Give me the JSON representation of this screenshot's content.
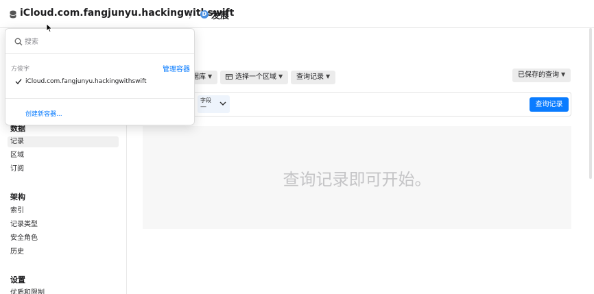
{
  "header": {
    "container_name": "iCloud.com.fangjunyu.hackingwithswift",
    "separator": "〉",
    "environment_badge": "D",
    "environment_name": "发展"
  },
  "sidebar": {
    "sections": [
      {
        "title": "数据",
        "items": [
          "记录",
          "区域",
          "订阅"
        ]
      },
      {
        "title": "架构",
        "items": [
          "索引",
          "记录类型",
          "安全角色",
          "历史"
        ]
      },
      {
        "title": "设置",
        "items": [
          "优质和限制"
        ]
      }
    ],
    "active_item": "记录"
  },
  "toolbar": {
    "database_label": "数据库",
    "zone_label": "选择一个区域",
    "query_mode_label": "查询记录",
    "saved_queries_label": "已保存的查询"
  },
  "query": {
    "field_label": "字段",
    "field_value": "—",
    "run_button": "查询记录"
  },
  "empty_state": {
    "message": "查询记录即可开始。"
  },
  "dropdown": {
    "search_placeholder": "搜索",
    "owner_name": "方俊宇",
    "manage_link": "管理容器",
    "containers": [
      "iCloud.com.fangjunyu.hackingwithswift"
    ],
    "create_link": "创建新容器..."
  },
  "colors": {
    "accent": "#0a7cff",
    "environment_badge": "#4a90e2",
    "empty_area_bg": "#f7f7f7"
  }
}
